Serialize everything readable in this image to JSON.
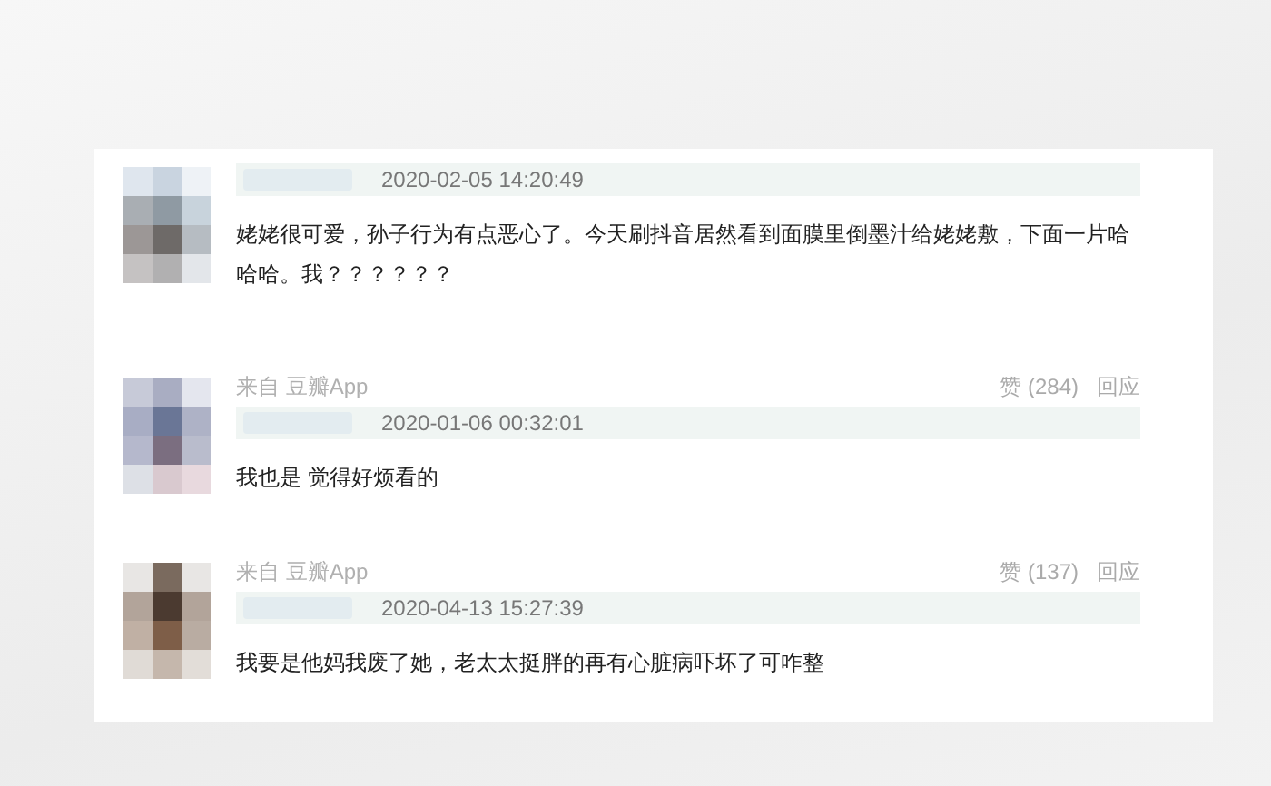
{
  "comments": [
    {
      "time": "2020-02-05 14:20:49",
      "text": "姥姥很可爱，孙子行为有点恶心了。今天刷抖音居然看到面膜里倒墨汁给姥姥敷，下面一片哈哈哈。我？？？？？？"
    },
    {
      "source": "来自 豆瓣App",
      "likes": "赞 (284)",
      "reply": "回应",
      "time": "2020-01-06 00:32:01",
      "text": "我也是 觉得好烦看的"
    },
    {
      "source": "来自 豆瓣App",
      "likes": "赞 (137)",
      "reply": "回应",
      "time": "2020-04-13 15:27:39",
      "text": "我要是他妈我废了她，老太太挺胖的再有心脏病吓坏了可咋整"
    }
  ]
}
